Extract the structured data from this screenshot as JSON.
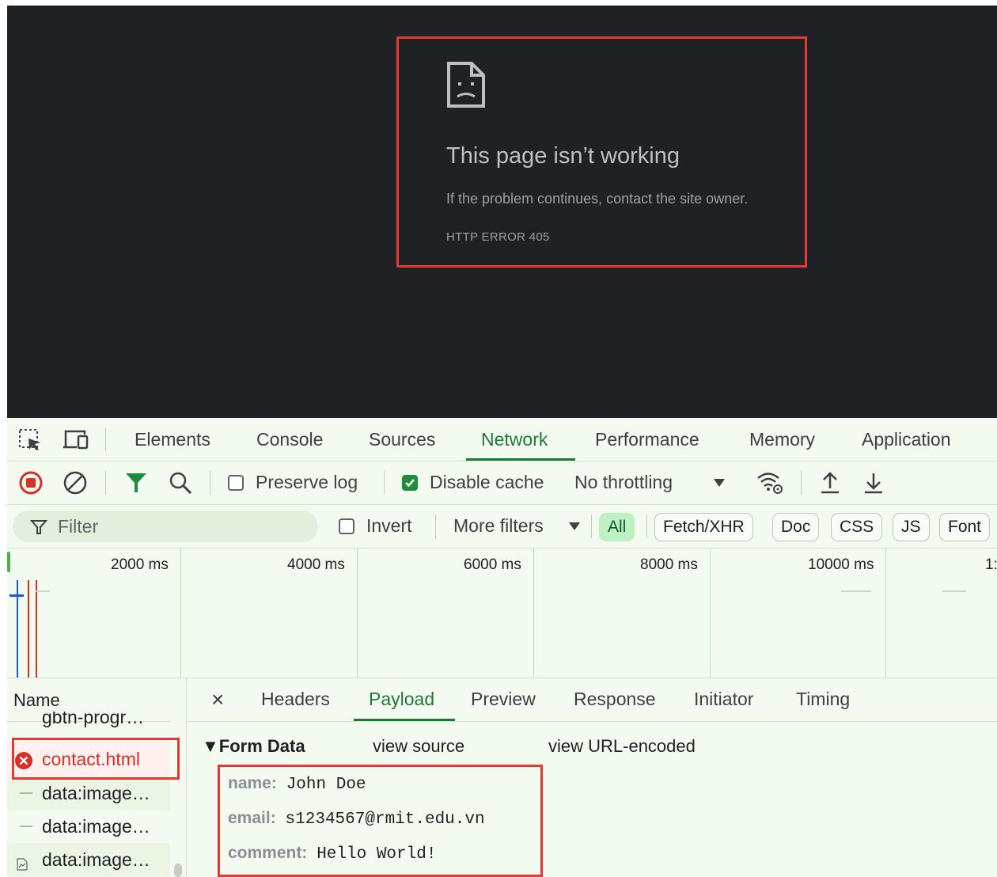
{
  "error_page": {
    "title": "This page isn’t working",
    "message": "If the problem continues, contact the site owner.",
    "code": "HTTP ERROR 405",
    "icon": "sad-page-icon",
    "highlight_color": "#e53935"
  },
  "devtools": {
    "tabs": [
      "Elements",
      "Console",
      "Sources",
      "Network",
      "Performance",
      "Memory",
      "Application"
    ],
    "active_tab": "Network",
    "toolbar": {
      "preserve_log_label": "Preserve log",
      "preserve_log_checked": false,
      "disable_cache_label": "Disable cache",
      "disable_cache_checked": true,
      "throttling": "No throttling"
    },
    "filter": {
      "placeholder": "Filter",
      "invert_label": "Invert",
      "more_filters_label": "More filters",
      "types": [
        "All",
        "Fetch/XHR",
        "Doc",
        "CSS",
        "JS",
        "Font"
      ],
      "active_type": "All"
    },
    "timeline": {
      "ticks": [
        "2000 ms",
        "4000 ms",
        "6000 ms",
        "8000 ms",
        "10000 ms",
        "1:"
      ]
    },
    "requests": {
      "header": "Name",
      "items": [
        {
          "name": "gbtn-progr…",
          "status": "ok"
        },
        {
          "name": "contact.html",
          "status": "error"
        },
        {
          "name": "data:image…",
          "status": "ok"
        },
        {
          "name": "data:image…",
          "status": "ok"
        },
        {
          "name": "data:image…",
          "status": "ok"
        }
      ]
    },
    "detail": {
      "close": "×",
      "tabs": [
        "Headers",
        "Payload",
        "Preview",
        "Response",
        "Initiator",
        "Timing"
      ],
      "active_tab": "Payload",
      "section_title": "▼Form Data",
      "view_source": "view source",
      "view_url_encoded": "view URL-encoded",
      "fields": [
        {
          "key": "name:",
          "value": "John Doe"
        },
        {
          "key": "email:",
          "value": "s1234567@rmit.edu.vn"
        },
        {
          "key": "comment:",
          "value": "Hello World!"
        }
      ]
    }
  }
}
